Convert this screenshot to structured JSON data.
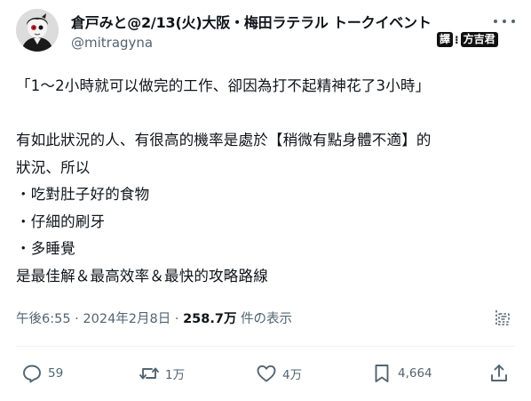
{
  "tweet": {
    "display_name": "倉戸みと@2/13(火)大阪・梅田ラテラル トークイベント",
    "handle": "@mitragyna",
    "translate_badge": {
      "left": "譯",
      "middle": "⁝",
      "right": "方吉君"
    },
    "text_lines": [
      "「1～2小時就可以做完的工作、卻因為打不起精神花了3小時」",
      "",
      "有如此狀況的人、有很高的機率是處於【稍微有點身體不適】的",
      "狀況、所以",
      "・吃對肚子好的食物",
      "・仔細的刷牙",
      "・多睡覺",
      "是最佳解＆最高效率＆最快的攻略路線"
    ],
    "timestamp": "午後6:55 · 2024年2月8日 · ",
    "views_count": "258.7万",
    "views_label": " 件の表示"
  },
  "actions": {
    "reply_count": "59",
    "retweet_count": "1万",
    "like_count": "4万",
    "bookmark_count": "4,664"
  },
  "colors": {
    "text": "#0f1419",
    "secondary": "#536471",
    "divider": "#eff3f4"
  },
  "icons": [
    "more-icon",
    "insights-icon",
    "reply-icon",
    "retweet-icon",
    "like-icon",
    "bookmark-icon",
    "share-icon"
  ]
}
